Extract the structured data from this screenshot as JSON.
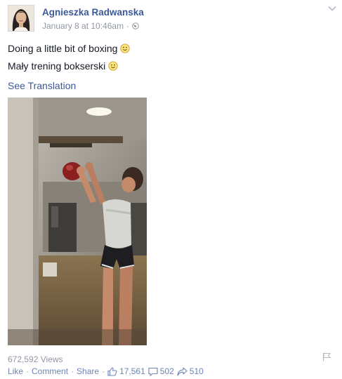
{
  "post": {
    "author": "Agnieszka Radwanska",
    "date": "January 8 at 10:46am",
    "separator": "·",
    "audience_icon": "globe-icon",
    "lines": [
      "Doing a little bit of boxing",
      "Mały trening bokserski"
    ],
    "see_translation": "See Translation",
    "views": "672,592 Views"
  },
  "actions": {
    "like": "Like",
    "comment": "Comment",
    "share": "Share",
    "dot": "·",
    "likes_count": "17,561",
    "comments_count": "502",
    "shares_count": "510"
  },
  "colors": {
    "link": "#3b5998",
    "muted": "#9197a3",
    "action": "#6d84b4"
  }
}
